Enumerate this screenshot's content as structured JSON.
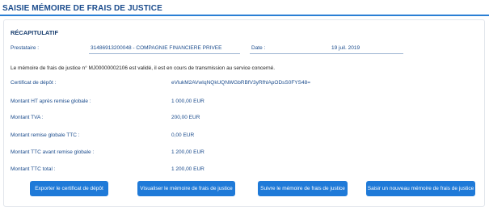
{
  "page": {
    "title": "Saisie mémoire de frais de justice"
  },
  "summary": {
    "title": "Récapitulatif",
    "prestataire_label": "Prestataire :",
    "prestataire_value": "31486913200048 - COMPAGNIE FINANCIERE PRIVEE",
    "date_label": "Date :",
    "date_value": "19 juil. 2019",
    "info_message": "Le mémoire de frais de justice n° MJ00000002106 est validé, il est en cours de transmission au service concerné.",
    "rows": [
      {
        "label": "Certificat de dépôt :",
        "value": "eVlukM2AVwIqNQkUQNWGbRBfV3yRfhlApODsS0FYS48="
      },
      {
        "label": "Montant HT après remise globale :",
        "value": "1 000,00 EUR"
      },
      {
        "label": "Montant TVA :",
        "value": "200,00 EUR"
      },
      {
        "label": "Montant remise globale TTC :",
        "value": "0,00 EUR"
      },
      {
        "label": "Montant TTC avant remise globale :",
        "value": "1 200,00 EUR"
      },
      {
        "label": "Montant TTC total :",
        "value": "1 200,00 EUR"
      }
    ]
  },
  "actions": {
    "export": "Exporter le certificat de dépôt",
    "view": "Visualiser le mémoire de frais de justice",
    "track": "Suivre le mémoire de frais de justice",
    "new": "Saisir un nouveau mémoire de frais de justice"
  },
  "colors": {
    "accent": "#1f7ad8",
    "heading": "#1a4b8c"
  }
}
